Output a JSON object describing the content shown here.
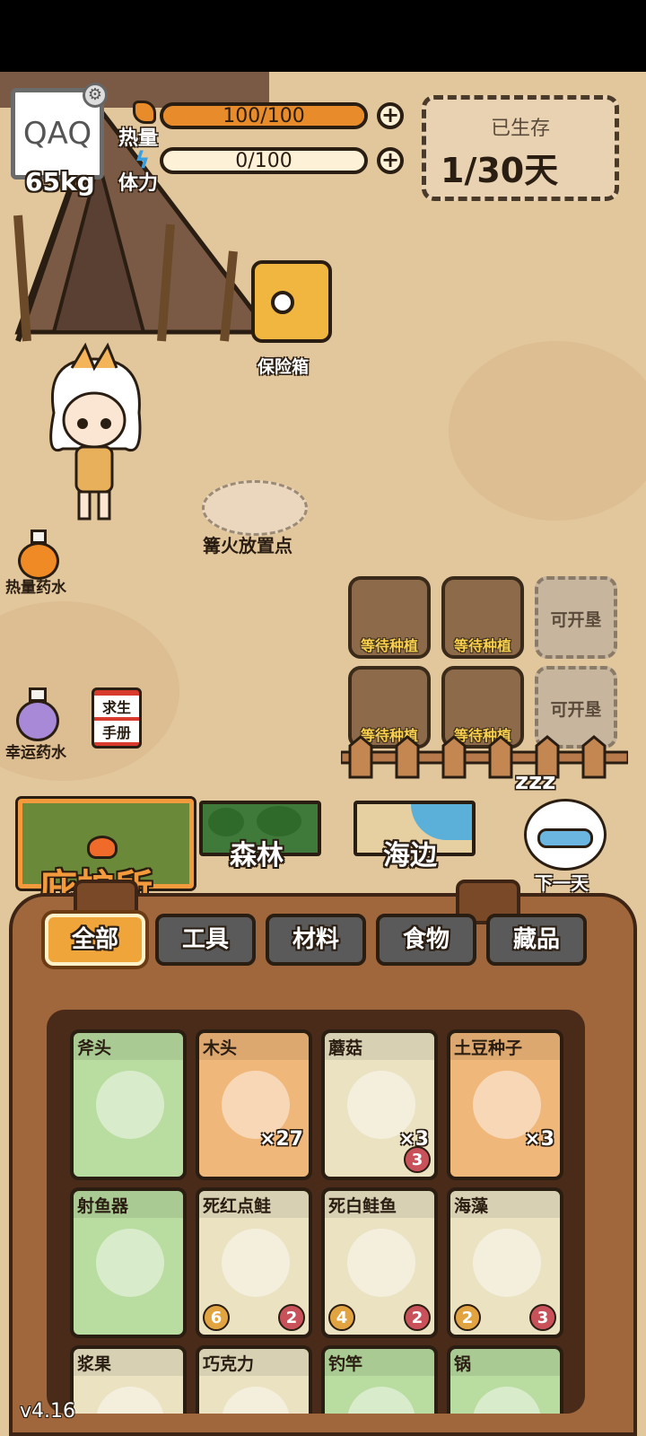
{
  "hud": {
    "avatar_text": "QAQ",
    "weight": "65kg",
    "heat_label": "热量",
    "heat_value": "100/100",
    "heat_fraction": 1.0,
    "stamina_label": "体力",
    "stamina_value": "0/100",
    "stamina_fraction": 0.0,
    "survived_title": "已生存",
    "survived_days": "1/30天"
  },
  "scene": {
    "safe_label": "保险箱",
    "campfire_label": "篝火放置点",
    "heat_potion_label": "热量药水",
    "luck_potion_label": "幸运药水",
    "manual_label_1": "求生",
    "manual_label_2": "手册",
    "next_day_label": "下一天",
    "sleep_icon": "zzz",
    "plots": [
      {
        "label": "等待种植"
      },
      {
        "label": "等待种植"
      },
      {
        "label": "可开垦"
      },
      {
        "label": "等待种植"
      },
      {
        "label": "等待种植"
      },
      {
        "label": "可开垦"
      }
    ]
  },
  "locations": {
    "shelter": "庇护所",
    "forest": "森林",
    "beach": "海边"
  },
  "tabs": [
    "全部",
    "工具",
    "材料",
    "食物",
    "藏品"
  ],
  "items": [
    {
      "name": "斧头",
      "qty": "",
      "left_badge": "",
      "right_badge": "",
      "color": "#b9dca0"
    },
    {
      "name": "木头",
      "qty": "×27",
      "left_badge": "",
      "right_badge": "",
      "color": "#f0b77a"
    },
    {
      "name": "蘑菇",
      "qty": "×3",
      "left_badge": "",
      "right_badge": "3",
      "color": "#ebe2c2"
    },
    {
      "name": "土豆种子",
      "qty": "×3",
      "left_badge": "",
      "right_badge": "",
      "color": "#f0b77a"
    },
    {
      "name": "射鱼器",
      "qty": "",
      "left_badge": "",
      "right_badge": "",
      "color": "#b9dca0"
    },
    {
      "name": "死红点鲑",
      "qty": "",
      "left_badge": "6",
      "right_badge": "2",
      "color": "#ebe2c2"
    },
    {
      "name": "死白鲑鱼",
      "qty": "",
      "left_badge": "4",
      "right_badge": "2",
      "color": "#ebe2c2"
    },
    {
      "name": "海藻",
      "qty": "",
      "left_badge": "2",
      "right_badge": "3",
      "color": "#ebe2c2"
    },
    {
      "name": "浆果",
      "qty": "",
      "left_badge": "",
      "right_badge": "",
      "color": "#ebe2c2"
    },
    {
      "name": "巧克力",
      "qty": "",
      "left_badge": "",
      "right_badge": "",
      "color": "#ebe2c2"
    },
    {
      "name": "钓竿",
      "qty": "",
      "left_badge": "",
      "right_badge": "",
      "color": "#b9dca0"
    },
    {
      "name": "锅",
      "qty": "",
      "left_badge": "",
      "right_badge": "",
      "color": "#b9dca0"
    }
  ],
  "version": "v4.16",
  "colors": {
    "heat_fill": "#e88b2a",
    "active_tab": "#f0a53a",
    "shelter_text": "#f39a3c"
  }
}
